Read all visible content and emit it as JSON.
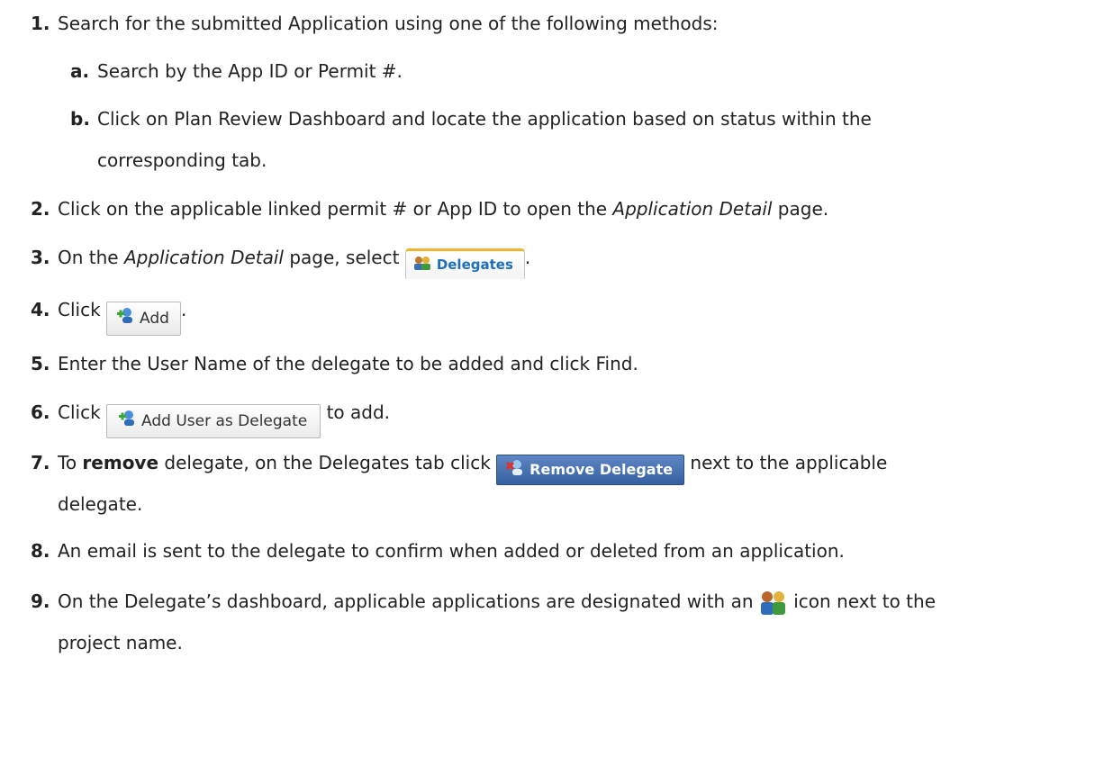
{
  "steps": [
    {
      "num": "1.",
      "text": "Search for the submitted Application using one of the following methods:"
    },
    {
      "num": "a.",
      "text": "Search by the App ID or Permit #."
    },
    {
      "num": "b.",
      "text": "Click on Plan Review Dashboard and locate the application based on status within the",
      "cont": "corresponding tab."
    },
    {
      "num": "2.",
      "pre": "Click on the applicable linked permit # or App ID to open the ",
      "em": "Application Detail",
      "post": " page."
    },
    {
      "num": "3.",
      "pre": "On the ",
      "em": "Application Detail",
      "post": " page, select ",
      "end": "."
    },
    {
      "num": "4.",
      "pre": "Click ",
      "end": "."
    },
    {
      "num": "5.",
      "text": "Enter the User Name of the delegate to be added and click Find."
    },
    {
      "num": "6.",
      "pre": "Click ",
      "post": " to add."
    },
    {
      "num": "7.",
      "pre": "To ",
      "strong": "remove",
      "post": " delegate, on the Delegates tab click ",
      "end": " next to the applicable",
      "cont": "delegate."
    },
    {
      "num": "8.",
      "text": "An email is sent to the delegate to confirm when added or deleted from an application."
    },
    {
      "num": "9.",
      "pre": "On the Delegate’s dashboard, applicable applications are designated with an ",
      "post": " icon next to the",
      "cont": "project name."
    }
  ],
  "buttons": {
    "delegates_tab": "Delegates",
    "add": "Add",
    "add_user_as_delegate": "Add User as Delegate",
    "remove_delegate": "Remove Delegate"
  },
  "icons": {
    "delegates": "delegates-users-icon",
    "add": "add-user-icon",
    "remove": "remove-user-icon",
    "delegate_badge": "delegate-badge-icon"
  },
  "colors": {
    "tab_accent": "#f2b531",
    "tab_text": "#1d6fb8",
    "remove_button": "#35609f"
  }
}
